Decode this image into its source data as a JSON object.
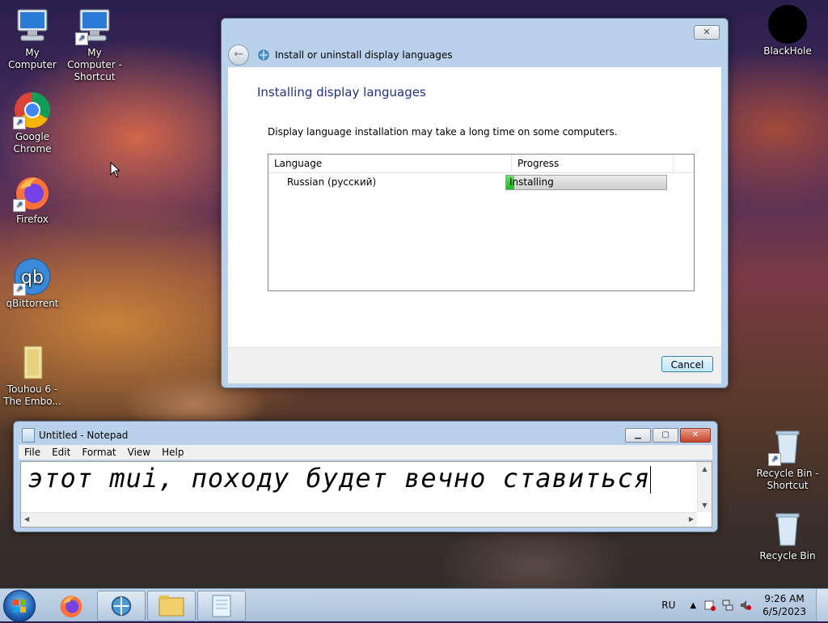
{
  "desktop": {
    "icons": [
      {
        "label": "My Computer"
      },
      {
        "label": "My Computer - Shortcut"
      },
      {
        "label": "Google Chrome"
      },
      {
        "label": "Firefox"
      },
      {
        "label": "qBittorrent"
      },
      {
        "label": "Touhou 6 - The Embo..."
      },
      {
        "label": "BlackHole"
      },
      {
        "label": "Recycle Bin - Shortcut"
      },
      {
        "label": "Recycle Bin"
      }
    ]
  },
  "dialog": {
    "close_label": "✕",
    "back_label": "←",
    "window_title": "Install or uninstall display languages",
    "main_title": "Installing display languages",
    "description": "Display language installation may take a long time on some computers.",
    "columns": [
      "Language",
      "Progress"
    ],
    "rows": [
      {
        "language": "Russian (русский)",
        "status": "Installing",
        "progress": 0.05
      }
    ],
    "cancel_label": "Cancel"
  },
  "notepad": {
    "title": "Untitled - Notepad",
    "menu": [
      "File",
      "Edit",
      "Format",
      "View",
      "Help"
    ],
    "content": "этот mui, походу будет вечно ставиться",
    "btn_min": "▁",
    "btn_max": "▢",
    "btn_close": "✕"
  },
  "taskbar": {
    "language": "RU",
    "time": "9:26 AM",
    "date": "6/5/2023",
    "tray_arrow": "▲"
  }
}
